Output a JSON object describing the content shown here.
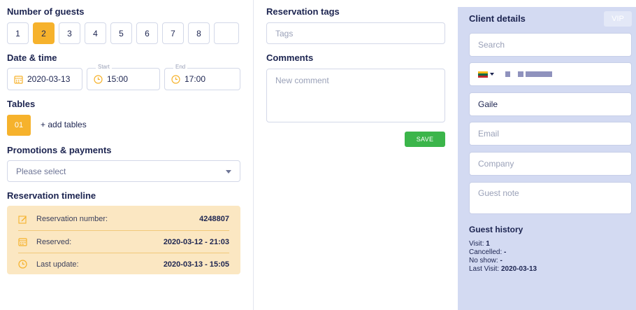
{
  "guests": {
    "title": "Number of guests",
    "options": [
      "1",
      "2",
      "3",
      "4",
      "5",
      "6",
      "7",
      "8",
      ""
    ],
    "selected": "2"
  },
  "datetime": {
    "title": "Date & time",
    "date": "2020-03-13",
    "start_caption": "Start",
    "start_time": "15:00",
    "end_caption": "End",
    "end_time": "17:00"
  },
  "tables": {
    "title": "Tables",
    "selected": "01",
    "add_label": "+ add tables"
  },
  "promotions": {
    "title": "Promotions & payments",
    "placeholder": "Please select"
  },
  "timeline": {
    "title": "Reservation timeline",
    "rows": [
      {
        "label": "Reservation number:",
        "value": "4248807",
        "icon": "edit-icon"
      },
      {
        "label": "Reserved:",
        "value": "2020-03-12 - 21:03",
        "icon": "calendar-icon"
      },
      {
        "label": "Last update:",
        "value": "2020-03-13 - 15:05",
        "icon": "clock-icon"
      }
    ]
  },
  "tags": {
    "title": "Reservation tags",
    "placeholder": "Tags"
  },
  "comments": {
    "title": "Comments",
    "placeholder": "New comment",
    "save_label": "SAVE"
  },
  "client": {
    "title": "Client details",
    "vip_label": "VIP",
    "search_placeholder": "Search",
    "phone_flag": "lithuania-flag-icon",
    "name_value": "Gaile",
    "email_placeholder": "Email",
    "company_placeholder": "Company",
    "note_placeholder": "Guest note"
  },
  "history": {
    "title": "Guest history",
    "visit_label": "Visit:",
    "visit_value": "1",
    "cancelled_label": "Cancelled:",
    "cancelled_value": "-",
    "noshow_label": "No show:",
    "noshow_value": "-",
    "last_visit_label": "Last Visit:",
    "last_visit_value": "2020-03-13"
  },
  "colors": {
    "accent": "#f6b22c",
    "save": "#3bb54a",
    "panel": "#d3daf2",
    "timeline_bg": "#fbe7c2",
    "text": "#1c2450"
  }
}
